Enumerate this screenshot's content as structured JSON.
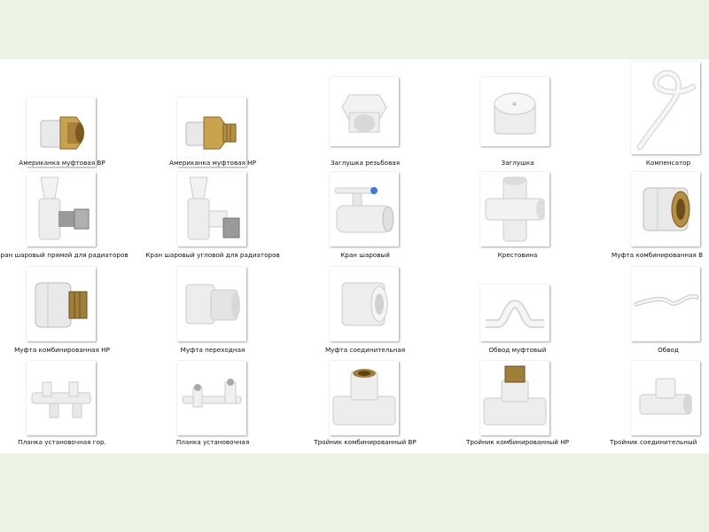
{
  "colors": {
    "background": "#ecf3e4",
    "panel": "#ffffff",
    "fitting_white": "#eeeeee",
    "brass": "#b8953f",
    "steel": "#9a9a9a",
    "valve_blue": "#3b7bd6"
  },
  "items": [
    {
      "label": "Американка муфтовая ВР",
      "icon": "union-fitting-female-icon"
    },
    {
      "label": "Американка муфтовая НР",
      "icon": "union-fitting-male-icon"
    },
    {
      "label": "Заглушка резьбовая",
      "icon": "threaded-plug-icon"
    },
    {
      "label": "Заглушка",
      "icon": "end-cap-icon"
    },
    {
      "label": "Компенсатор",
      "icon": "compensator-loop-icon"
    },
    {
      "label": "Кран шаровый прямой для радиаторов",
      "icon": "radiator-valve-straight-icon"
    },
    {
      "label": "Кран шаровый угловой для радиаторов",
      "icon": "radiator-valve-angle-icon"
    },
    {
      "label": "Кран шаровый",
      "icon": "ball-valve-icon"
    },
    {
      "label": "Крестовина",
      "icon": "cross-fitting-icon"
    },
    {
      "label": "Муфта комбинированная В",
      "icon": "combined-coupling-female-icon"
    },
    {
      "label": "Муфта комбинированная НР",
      "icon": "combined-coupling-male-icon"
    },
    {
      "label": "Муфта переходная",
      "icon": "reducing-coupling-icon"
    },
    {
      "label": "Муфта соединительная",
      "icon": "coupling-icon"
    },
    {
      "label": "Обвод муфтовый",
      "icon": "crossover-bend-socket-icon"
    },
    {
      "label": "Обвод",
      "icon": "crossover-bend-icon"
    },
    {
      "label": "Планка установочная гор.",
      "icon": "mounting-bracket-horizontal-icon"
    },
    {
      "label": "Планка установочная",
      "icon": "mounting-bracket-icon"
    },
    {
      "label": "Тройник комбинированный ВР",
      "icon": "tee-combined-female-icon"
    },
    {
      "label": "Тройник комбинированный НР",
      "icon": "tee-combined-male-icon"
    },
    {
      "label": "Тройник соединительный",
      "icon": "tee-icon"
    }
  ]
}
